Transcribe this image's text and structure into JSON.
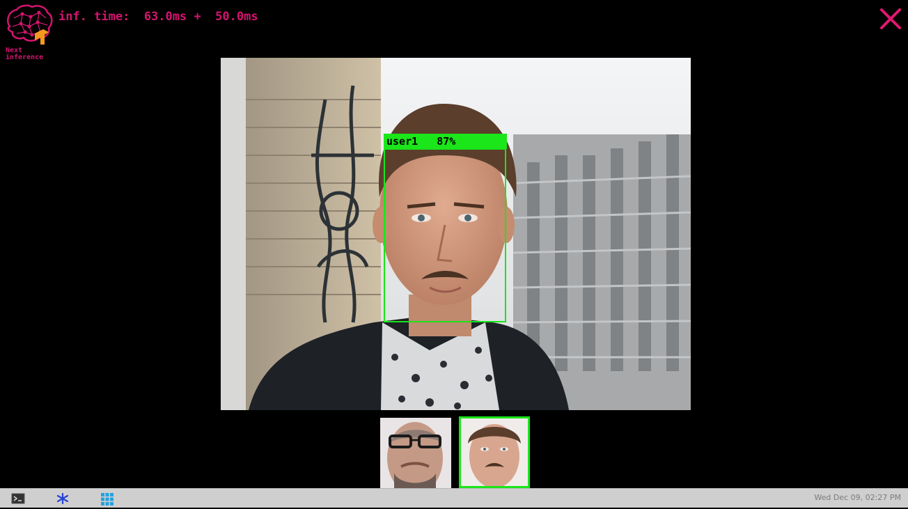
{
  "header": {
    "inference_label": "inf. time:  63.0ms +  50.0ms",
    "logo_line1": "Next",
    "logo_line2": "inference"
  },
  "detection": {
    "label": "user1   87%",
    "box_color": "#19e619"
  },
  "thumbnails": [
    {
      "name": "face-glasses"
    },
    {
      "name": "face-user1",
      "selected": true
    }
  ],
  "taskbar": {
    "clock": "Wed Dec 09, 02:27 PM",
    "icons": [
      "terminal-icon",
      "bluetooth-icon",
      "app-grid-icon"
    ]
  },
  "colors": {
    "accent": "#d4146f",
    "detection": "#19e619",
    "close": "#e2176f"
  }
}
